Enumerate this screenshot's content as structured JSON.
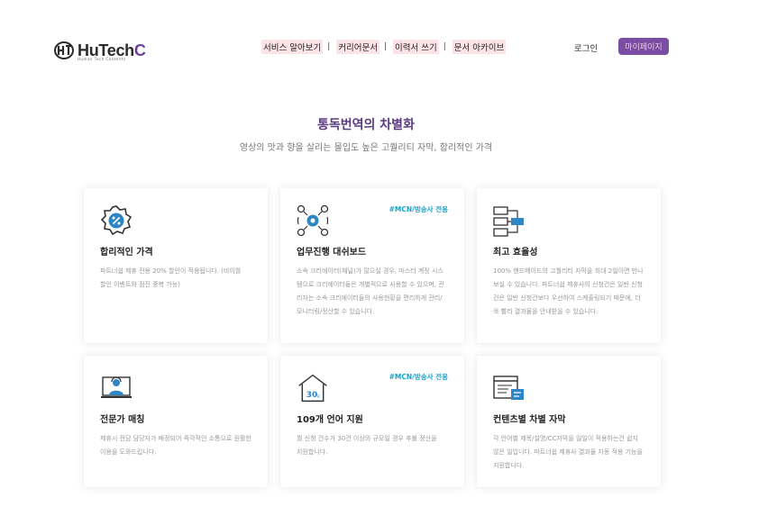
{
  "header": {
    "logo_text": "HuTech",
    "logo_accent": "C",
    "logo_sub": "Human Tech Contents",
    "nav": [
      "서비스 알아보기",
      "커리어문서",
      "이력서 쓰기",
      "문서 아카이브"
    ],
    "login": "로그인",
    "mypage": "마이페이지"
  },
  "hero": {
    "title": "통독번역의 차별화",
    "subtitle": "영상의 맛과 향을 살리는 몰입도 높은 고퀄리티 자막, 합리적인 가격"
  },
  "cards": [
    {
      "icon": "discount-badge-icon",
      "title": "합리적인 가격",
      "desc": "파트너쉽 제휴 전용 20% 할인이 적용됩니다. (비이월 할인 이벤트와 점진 중복 가능)",
      "tag": ""
    },
    {
      "icon": "workflow-dashboard-icon",
      "title": "업무진행 대쉬보드",
      "desc": "소속 크리에이터(채널)가 많으실 경우, 마스터 계정 시스 템으로 크리에이터들은 개별적으로 사용할 수 있으며, 관 리자는 소속 크리에이터들의 사용현황을 편리하게 관리/ 모니터링/정산할 수 있습니다.",
      "tag": "#MCN/방송사 전용"
    },
    {
      "icon": "efficiency-icon",
      "title": "최고 효율성",
      "desc": "100% 핸드메이드의 고퀄리티 자막을 최대 2일이면 만나 보실 수 있습니다. 파트너쉽 제휴사의 신청건은 일반 신청 건은 일반 신청건보다 우선하여 스케줄링되기 때문에, 더 욱 빨리 결과물을 안내받을 수 있습니다.",
      "tag": ""
    },
    {
      "icon": "expert-matching-icon",
      "title": "전문가 매칭",
      "desc": "제휴시 전담 담당자가 배정되어 즉각적인 소통으로 원활한 이용을 도와드립니다.",
      "tag": ""
    },
    {
      "icon": "languages-109-icon",
      "title": "109개 언어 지원",
      "desc": "월 신청 건수가 30건 이상의 규모일 경우 후불 정산을 지원합니다.",
      "tag": "#MCN/방송사 전용"
    },
    {
      "icon": "custom-subtitle-icon",
      "title": "컨텐츠별 차별 자막",
      "desc": "각 언어별 제목/설명/CC자막을 일일이 적용하는건 쉽지 않은 일입니다. 파트너쉽 제휴사 결과물 자동 적용 기능을 지원합니다.",
      "tag": ""
    }
  ],
  "icon_text": {
    "thirty_days": "30",
    "day_unit": "일"
  },
  "colors": {
    "brand_purple": "#6b3fa0",
    "nav_highlight": "#fbe3e8",
    "button_bg": "#7b4ea6",
    "tag_blue": "#1aa3c9"
  }
}
